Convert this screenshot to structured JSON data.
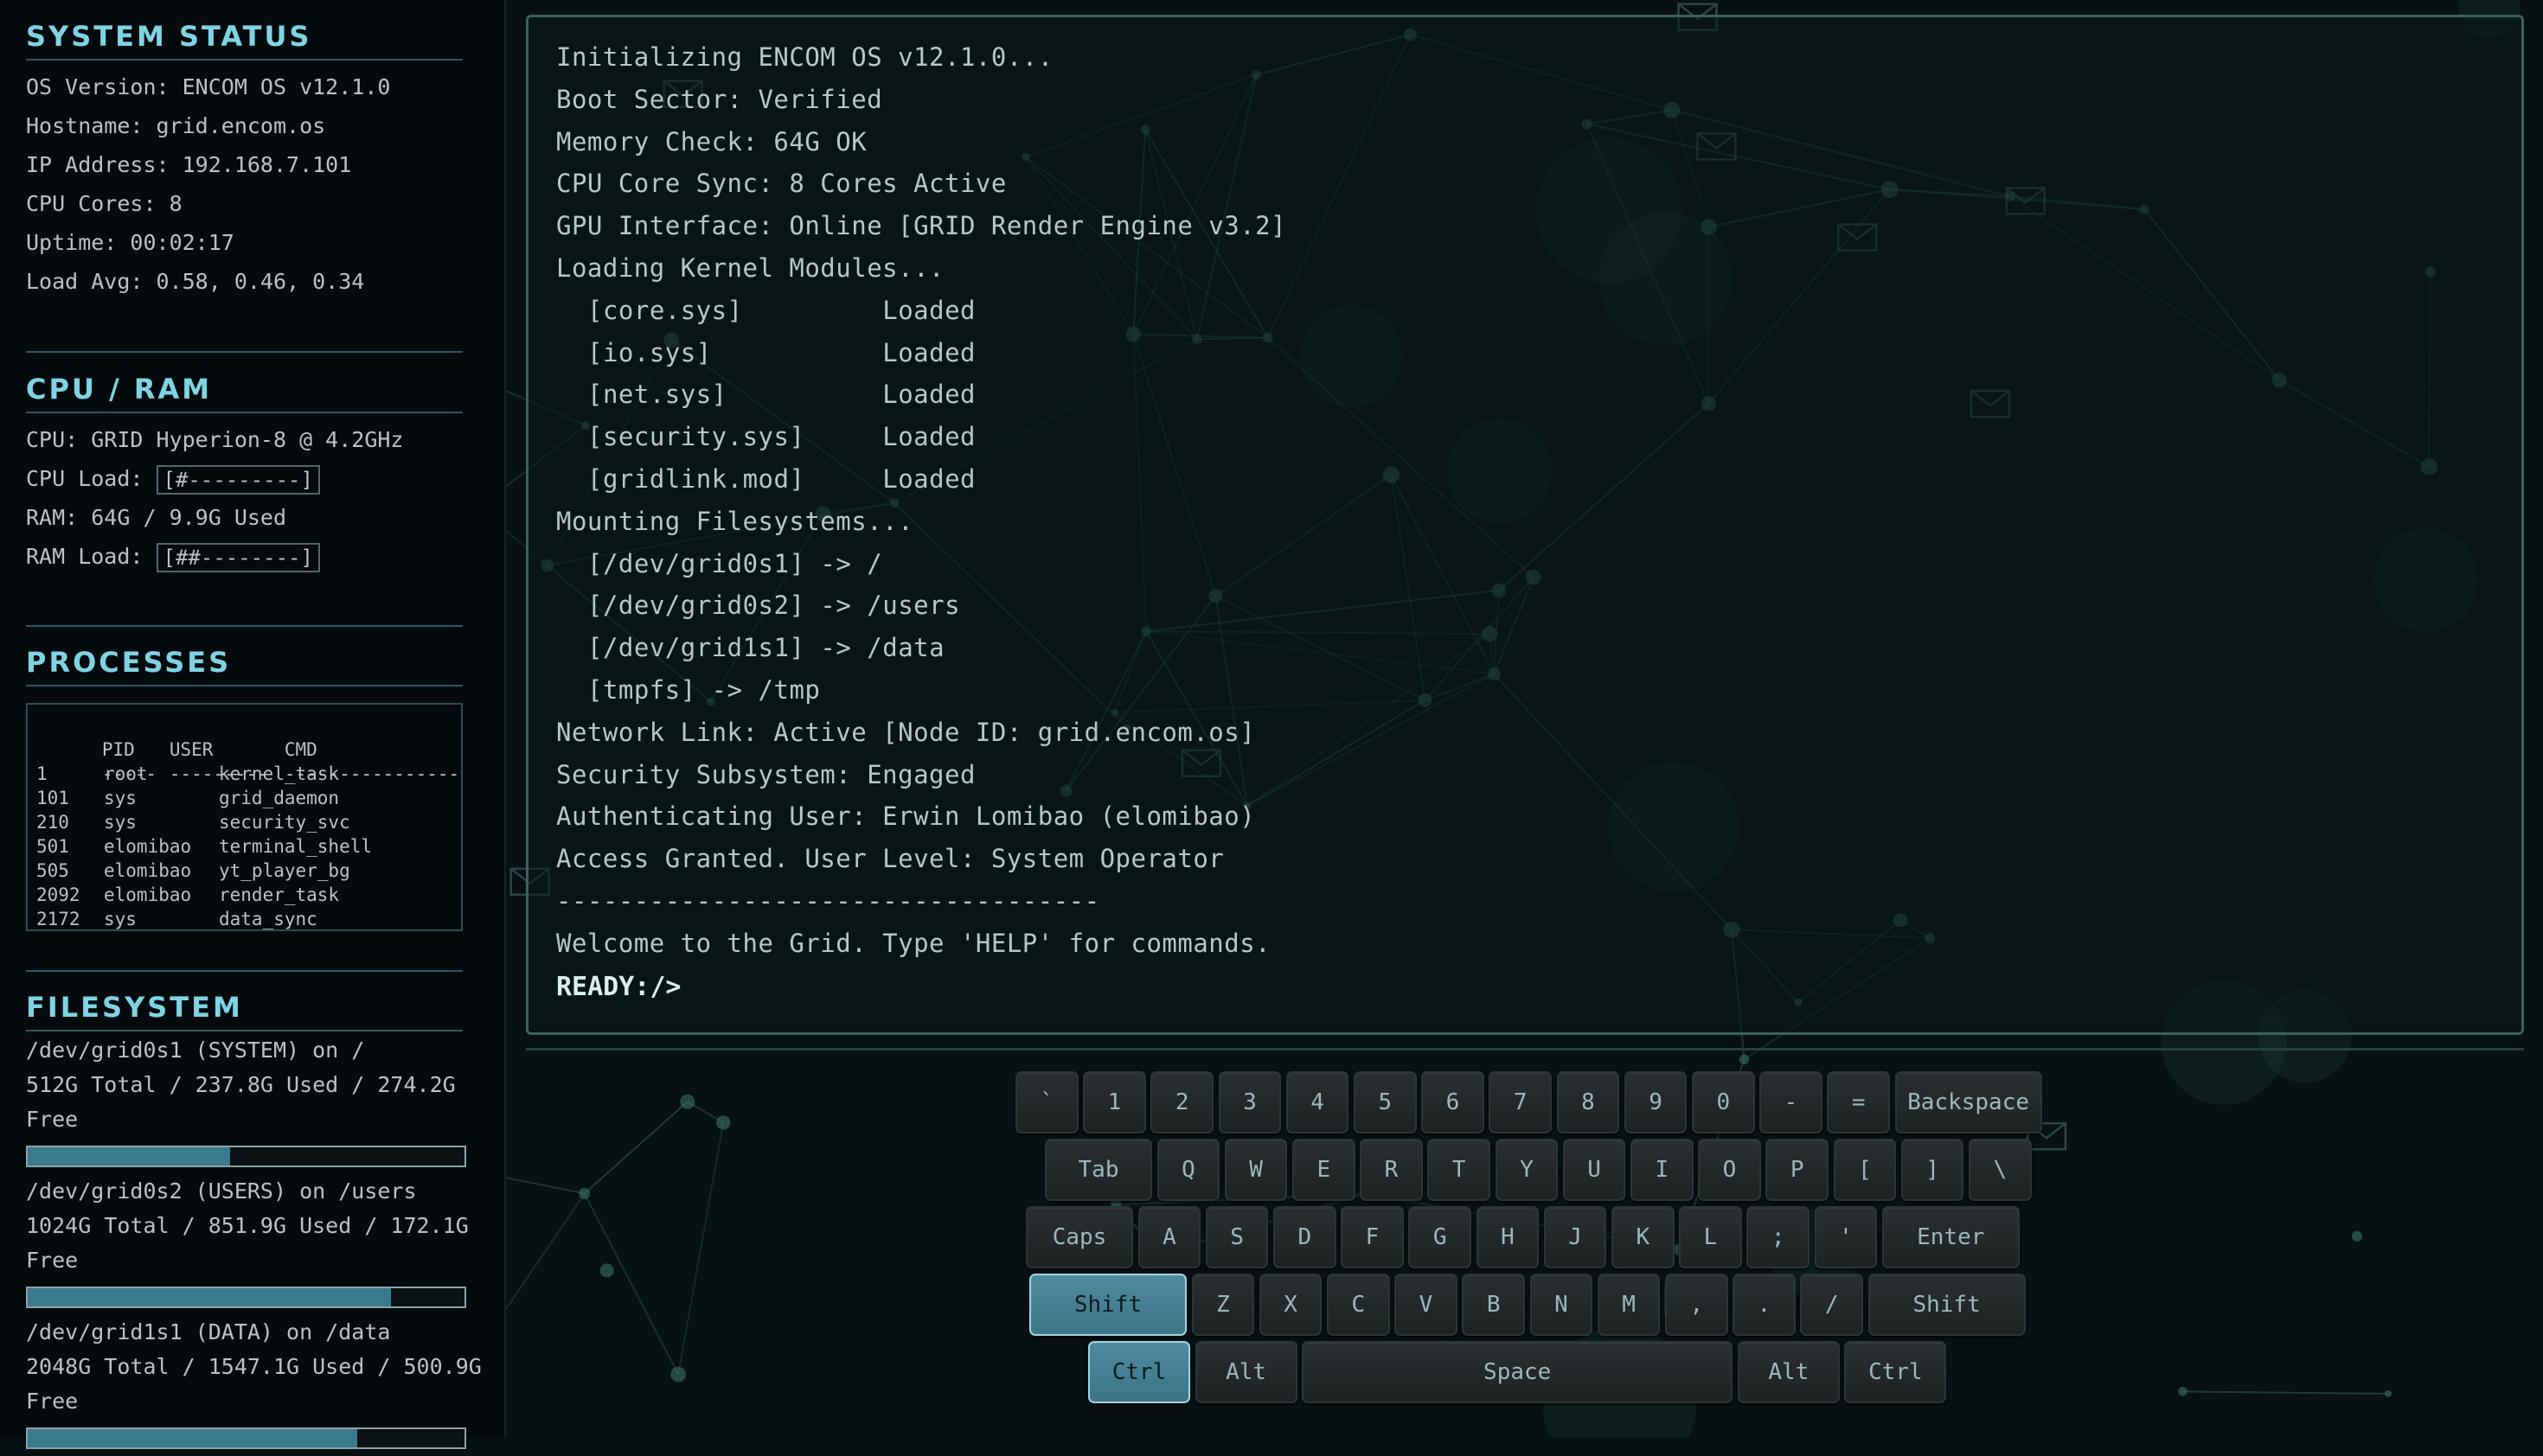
{
  "system_status": {
    "title": "SYSTEM STATUS",
    "os_version": "OS Version: ENCOM OS v12.1.0",
    "hostname": "Hostname: grid.encom.os",
    "ip": "IP Address: 192.168.7.101",
    "cpu_cores": "CPU Cores: 8",
    "uptime": "Uptime: 00:02:17",
    "load_avg": "Load Avg: 0.58, 0.46, 0.34"
  },
  "cpu_ram": {
    "title": "CPU / RAM",
    "cpu": "CPU: GRID Hyperion-8 @ 4.2GHz",
    "cpu_load_label": "CPU Load:",
    "cpu_load_bar": "[#---------]",
    "ram": "RAM: 64G / 9.9G Used",
    "ram_load_label": "RAM Load:",
    "ram_load_bar": "[##--------]"
  },
  "processes": {
    "title": "PROCESSES",
    "headers": [
      "PID",
      "USER",
      "CMD"
    ],
    "divider": [
      "-----",
      "---------",
      "----------------"
    ],
    "rows": [
      [
        "1",
        "root",
        "kernel_task"
      ],
      [
        "101",
        "sys",
        "grid_daemon"
      ],
      [
        "210",
        "sys",
        "security_svc"
      ],
      [
        "501",
        "elomibao",
        "terminal_shell"
      ],
      [
        "505",
        "elomibao",
        "yt_player_bg"
      ],
      [
        "2092",
        "elomibao",
        "render_task"
      ],
      [
        "2172",
        "sys",
        "data_sync"
      ]
    ]
  },
  "filesystem": {
    "title": "FILESYSTEM",
    "mounts": [
      {
        "line1": "/dev/grid0s1 (SYSTEM) on /",
        "line2": "512G Total / 237.8G Used / 274.2G",
        "line3": "Free",
        "used_fraction": 0.464
      },
      {
        "line1": "/dev/grid0s2 (USERS) on /users",
        "line2": "1024G Total / 851.9G Used / 172.1G",
        "line3": "Free",
        "used_fraction": 0.832
      },
      {
        "line1": "/dev/grid1s1 (DATA) on /data",
        "line2": "2048G Total / 1547.1G Used / 500.9G",
        "line3": "Free",
        "used_fraction": 0.755
      }
    ]
  },
  "terminal": {
    "lines": [
      {
        "text": "Initializing ENCOM OS v12.1.0...",
        "indent": false
      },
      {
        "text": "Boot Sector: Verified",
        "indent": false
      },
      {
        "text": "Memory Check: 64G OK",
        "indent": false
      },
      {
        "text": "CPU Core Sync: 8 Cores Active",
        "indent": false
      },
      {
        "text": "GPU Interface: Online [GRID Render Engine v3.2]",
        "indent": false
      },
      {
        "text": "Loading Kernel Modules...",
        "indent": false
      },
      {
        "text": "[core.sys]         Loaded",
        "indent": true
      },
      {
        "text": "[io.sys]           Loaded",
        "indent": true
      },
      {
        "text": "[net.sys]          Loaded",
        "indent": true
      },
      {
        "text": "[security.sys]     Loaded",
        "indent": true
      },
      {
        "text": "[gridlink.mod]     Loaded",
        "indent": true
      },
      {
        "text": "Mounting Filesystems...",
        "indent": false
      },
      {
        "text": "[/dev/grid0s1] -> /",
        "indent": true
      },
      {
        "text": "[/dev/grid0s2] -> /users",
        "indent": true
      },
      {
        "text": "[/dev/grid1s1] -> /data",
        "indent": true
      },
      {
        "text": "[tmpfs] -> /tmp",
        "indent": true
      },
      {
        "text": "Network Link: Active [Node ID: grid.encom.os]",
        "indent": false
      },
      {
        "text": "Security Subsystem: Engaged",
        "indent": false
      },
      {
        "text": "Authenticating User: Erwin Lomibao (elomibao)",
        "indent": false
      },
      {
        "text": "Access Granted. User Level: System Operator",
        "indent": false
      },
      {
        "text": "-----------------------------------",
        "indent": false
      },
      {
        "text": "Welcome to the Grid. Type 'HELP' for commands.",
        "indent": false
      }
    ],
    "prompt": "READY:/>"
  },
  "keyboard": {
    "rows": [
      [
        "`",
        "1",
        "2",
        "3",
        "4",
        "5",
        "6",
        "7",
        "8",
        "9",
        "0",
        "-",
        "=",
        "Backspace"
      ],
      [
        "Tab",
        "Q",
        "W",
        "E",
        "R",
        "T",
        "Y",
        "U",
        "I",
        "O",
        "P",
        "[",
        "]",
        "\\"
      ],
      [
        "Caps",
        "A",
        "S",
        "D",
        "F",
        "G",
        "H",
        "J",
        "K",
        "L",
        ";",
        "'",
        "Enter"
      ],
      [
        "Shift",
        "Z",
        "X",
        "C",
        "V",
        "B",
        "N",
        "M",
        ",",
        ".",
        "/",
        "Shift"
      ],
      [
        "Ctrl",
        "Alt",
        "Space",
        "Alt",
        "Ctrl"
      ]
    ],
    "active_keys": [
      "3:0",
      "4:0"
    ]
  }
}
